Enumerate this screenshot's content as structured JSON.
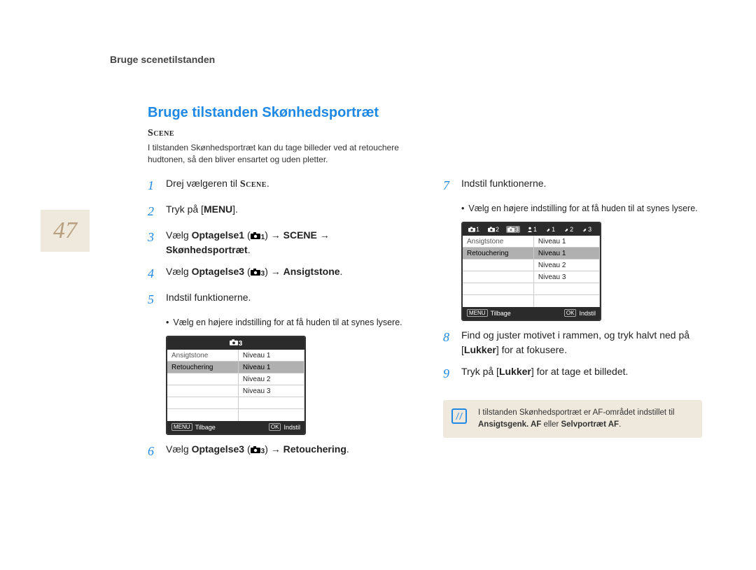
{
  "page_number": "47",
  "header": "Bruge scenetilstanden",
  "title": "Bruge tilstanden Skønhedsportræt",
  "scene_word": "Scene",
  "intro": "I tilstanden Skønhedsportræt kan du tage billeder ved at retouchere hudtonen, så den bliver ensartet og uden pletter.",
  "steps": {
    "1": {
      "pre": "Drej vælgeren til ",
      "post": "."
    },
    "2": {
      "pre": "Tryk på [",
      "bold": "MENU",
      "post": "]."
    },
    "3": {
      "pre": "Vælg ",
      "b1": "Optagelse1",
      "mid1": " (",
      "cam": "1",
      "mid2": ")  → ",
      "b2": "SCENE",
      "mid3": " → ",
      "b3": "Skønhedsportræt",
      "post": "."
    },
    "4": {
      "pre": "Vælg ",
      "b1": "Optagelse3",
      "mid1": " (",
      "cam": "3",
      "mid2": ")  → ",
      "b2": "Ansigtstone",
      "post": "."
    },
    "5": {
      "text": "Indstil funktionerne."
    },
    "sub5": "Vælg en højere indstilling for at få huden til at synes lysere.",
    "6": {
      "pre": "Vælg ",
      "b1": "Optagelse3",
      "mid1": " (",
      "cam": "3",
      "mid2": ")  → ",
      "b2": "Retouchering",
      "post": "."
    },
    "7": {
      "text": "Indstil funktionerne."
    },
    "sub7": "Vælg en højere indstilling for at få huden til at synes lysere.",
    "8": {
      "pre": "Find og juster motivet i rammen, og tryk halvt ned på [",
      "bold": "Lukker",
      "post": "] for at fokusere."
    },
    "9": {
      "pre": "Tryk på [",
      "bold": "Lukker",
      "post": "] for at tage et billedet."
    }
  },
  "lcd_common": {
    "labels": [
      "Ansigtstone",
      "Retouchering"
    ],
    "values": [
      "Niveau 1",
      "Niveau 1",
      "Niveau 2",
      "Niveau 3"
    ],
    "menu": "MENU",
    "back": "Tilbage",
    "ok": "OK",
    "set": "Indstil"
  },
  "lcd1_top_label": "3",
  "lcd2_tabs": {
    "cam": [
      "1",
      "2",
      "3"
    ],
    "person": [
      "1"
    ],
    "wrench": [
      "1",
      "2",
      "3"
    ]
  },
  "note": {
    "pre": "I tilstanden Skønhedsportræt er AF-området indstillet til ",
    "b1": "Ansigtsgenk. AF",
    "mid": " eller ",
    "b2": "Selvportræt AF",
    "post": "."
  }
}
